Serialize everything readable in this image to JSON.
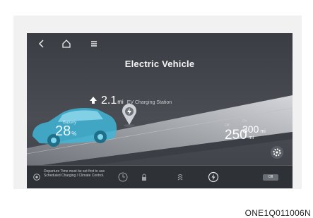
{
  "screen": {
    "title": "Electric Vehicle",
    "nav": {
      "back_icon": "back-icon",
      "home_icon": "home-icon",
      "menu_icon": "menu-icon"
    }
  },
  "vehicle": {
    "battery_label": "Battery",
    "battery_value": "28",
    "battery_unit": "%"
  },
  "destination": {
    "distance": "2.1",
    "unit": "mi",
    "name": "EV Charging Station"
  },
  "range": {
    "off": {
      "label": "Off",
      "value": "250",
      "unit": "mi"
    },
    "on": {
      "label": "On",
      "value": "300",
      "unit": "mi"
    }
  },
  "bottom_bar": {
    "notice": "Departure Time must be set first to use Scheduled Charging / Climate Control.",
    "pill_label": "Off"
  },
  "caption": "ONE1Q011006N",
  "colors": {
    "car_accent": "#3fb6d8",
    "road": "#9b9ea4"
  }
}
